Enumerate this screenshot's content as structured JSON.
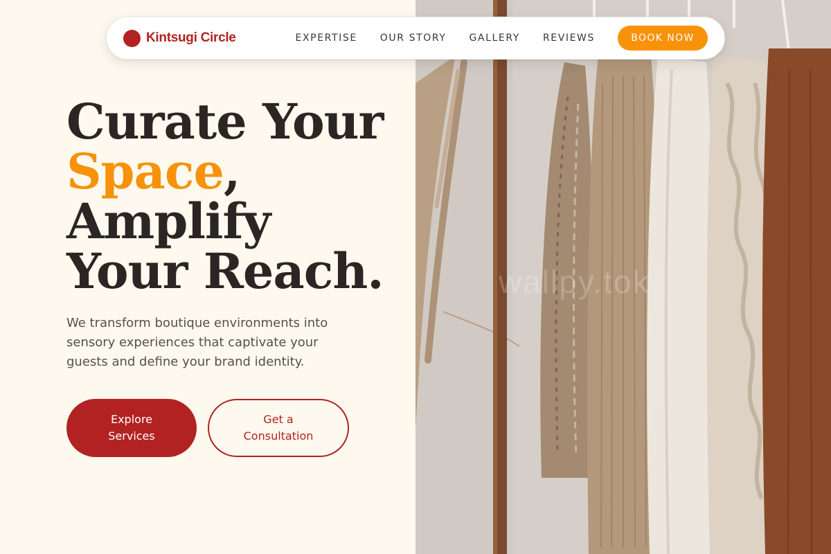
{
  "brand": {
    "name": "Kintsugi Circle",
    "dot_color": "#b22222"
  },
  "nav": {
    "links": [
      "EXPERTISE",
      "OUR STORY",
      "GALLERY",
      "REVIEWS"
    ],
    "cta": "BOOK NOW"
  },
  "hero": {
    "headline": {
      "line1": "Curate Your",
      "accent": "Space",
      "accent_suffix": ",",
      "line3": "Amplify",
      "line4": "Your Reach."
    },
    "subtext": "We transform boutique environments into sensory experiences that captivate your guests and define your brand identity.",
    "primary_button": "Explore Services",
    "secondary_button": "Get a Consultation",
    "image_watermark": "wallpy.tok"
  },
  "colors": {
    "background": "#fdf9ee",
    "brand_red": "#b22222",
    "accent_orange": "#f7920a",
    "heading": "#2b2623",
    "body_text": "#555049"
  }
}
